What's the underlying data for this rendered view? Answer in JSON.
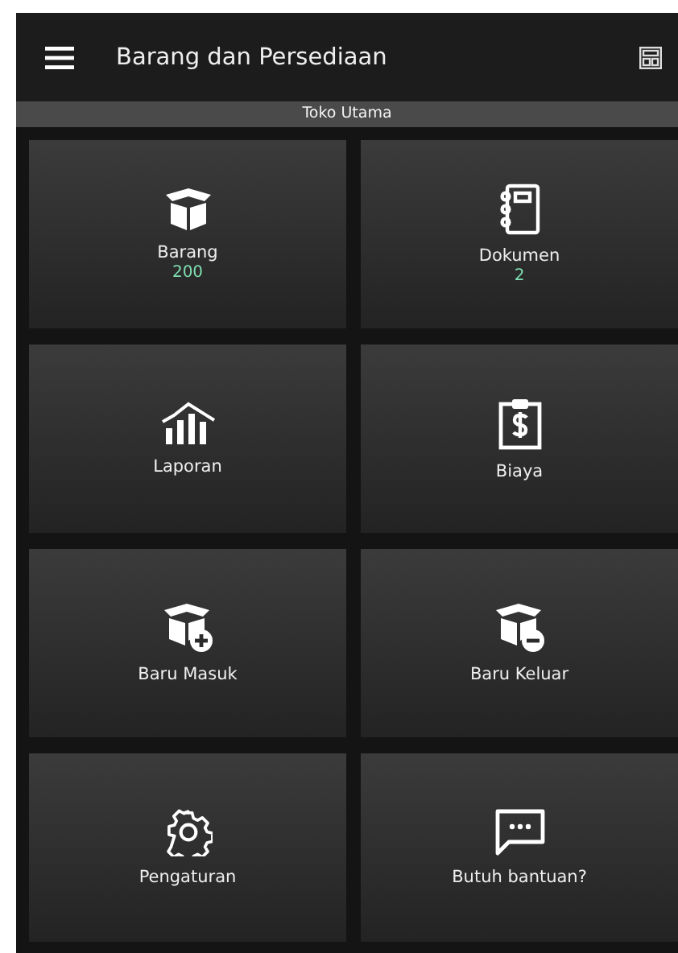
{
  "app_bar": {
    "title": "Barang dan Persediaan"
  },
  "store": {
    "name": "Toko Utama"
  },
  "tiles": [
    {
      "kind": "box",
      "label": "Barang",
      "count": "200"
    },
    {
      "kind": "notebook",
      "label": "Dokumen",
      "count": "2"
    },
    {
      "kind": "chart",
      "label": "Laporan"
    },
    {
      "kind": "expense",
      "label": "Biaya"
    },
    {
      "kind": "box-in",
      "label": "Baru Masuk"
    },
    {
      "kind": "box-out",
      "label": "Baru Keluar"
    },
    {
      "kind": "gear",
      "label": "Pengaturan"
    },
    {
      "kind": "chat",
      "label": "Butuh bantuan?"
    }
  ]
}
